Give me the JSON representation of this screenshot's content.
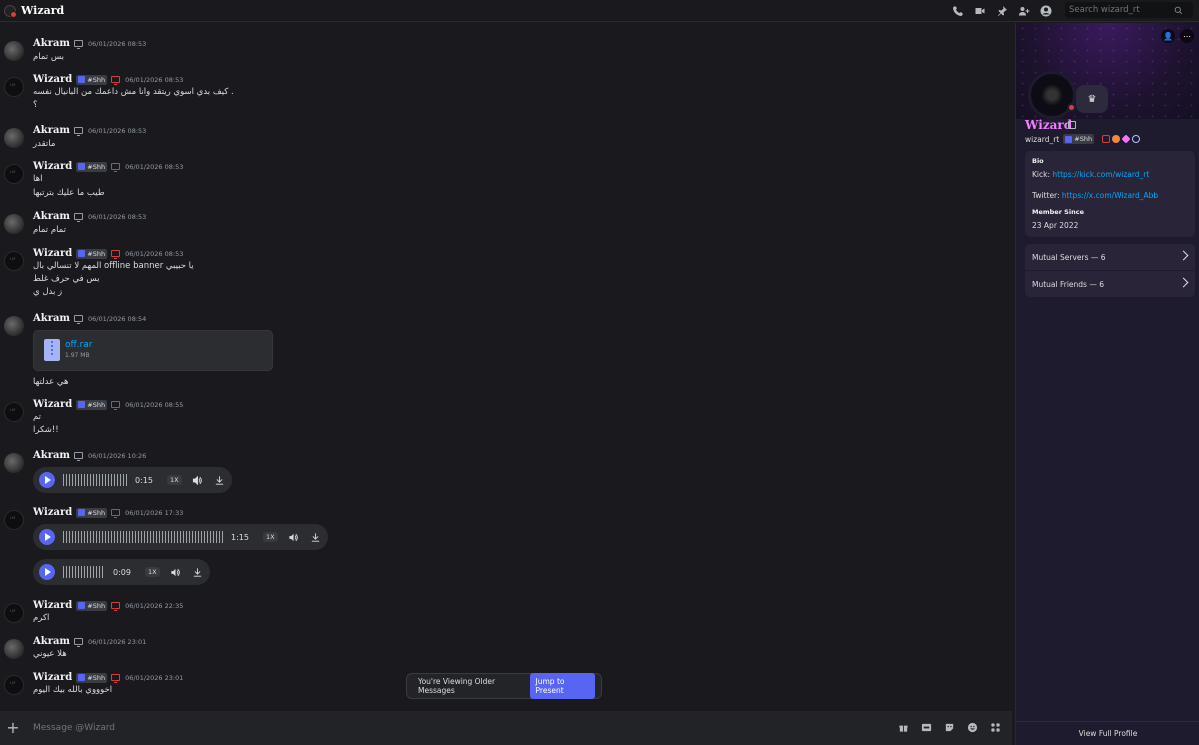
{
  "window": {
    "title": "Wizard"
  },
  "search": {
    "placeholder": "Search wizard_rt"
  },
  "messages": [
    {
      "author": "Akram",
      "time": "06/01/2026 08:53",
      "lines": [
        "بس تمام"
      ]
    },
    {
      "author": "Wizard",
      "tag": "#Shh",
      "time": "06/01/2026 08:53",
      "lines": [
        "كيف بدي اسوي ريتقد وانا مش داعمك من البانيال نفسه .",
        "؟"
      ]
    },
    {
      "author": "Akram",
      "time": "06/01/2026 08:53",
      "lines": [
        "ماتقدر"
      ]
    },
    {
      "author": "Wizard",
      "tag": "#Shh",
      "time": "06/01/2026 08:53",
      "lines": [
        "اها",
        "طيب ما عليك بترتبها"
      ]
    },
    {
      "author": "Akram",
      "time": "06/01/2026 08:53",
      "lines": [
        "تمام تمام"
      ]
    },
    {
      "author": "Wizard",
      "tag": "#Shh",
      "time": "06/01/2026 08:53",
      "lines": [
        "المهم لا تنسالي بال offline banner يا حبيبي",
        "بس في حرف غلط",
        "ز بدل ي"
      ]
    },
    {
      "author": "Akram",
      "time": "06/01/2026 08:54",
      "attachment": {
        "name": "off.rar",
        "size": "1.97 MB"
      },
      "lines": [
        "هي عدلتها"
      ]
    },
    {
      "author": "Wizard",
      "tag": "#Shh",
      "time": "06/01/2026 08:55",
      "lines": [
        "تم",
        "شكرا!!"
      ]
    },
    {
      "author": "Akram",
      "time": "06/01/2026 10:26",
      "voice": [
        {
          "duration": "0:15",
          "speed": "1X"
        }
      ]
    },
    {
      "author": "Wizard",
      "tag": "#Shh",
      "time": "06/01/2026 17:33",
      "voice": [
        {
          "duration": "1:15",
          "speed": "1X"
        },
        {
          "duration": "0:09",
          "speed": "1X"
        }
      ]
    },
    {
      "author": "Wizard",
      "tag": "#Shh",
      "time": "06/01/2026 22:35",
      "lines": [
        "اكرم"
      ]
    },
    {
      "author": "Akram",
      "time": "06/01/2026 23:01",
      "lines": [
        "هلا عيوني"
      ]
    },
    {
      "author": "Wizard",
      "tag": "#Shh",
      "time": "06/01/2026 23:01",
      "lines": [
        "اخوووي بالله بيك اليوم"
      ]
    }
  ],
  "older_banner": {
    "text": "You're Viewing Older Messages",
    "button": "Jump to Present"
  },
  "composer": {
    "placeholder": "Message @Wizard"
  },
  "profile": {
    "display_name": "Wizard",
    "username": "wizard_rt",
    "tag": "#Shh",
    "bio_heading": "Bio",
    "kick_label": "Kick: ",
    "kick_link": "https://kick.com/wizard_rt",
    "twitter_label": "Twitter: ",
    "twitter_link": "https://x.com/Wizard_Abb",
    "member_since_heading": "Member Since",
    "member_since": "23 Apr 2022",
    "mutual_servers": "Mutual Servers — 6",
    "mutual_friends": "Mutual Friends — 6",
    "view_full": "View Full Profile"
  },
  "colors": {
    "accent": "#5865f2",
    "link": "#00a8fc",
    "status_dnd": "#d83c3e",
    "profile_name": "#f47fff"
  }
}
